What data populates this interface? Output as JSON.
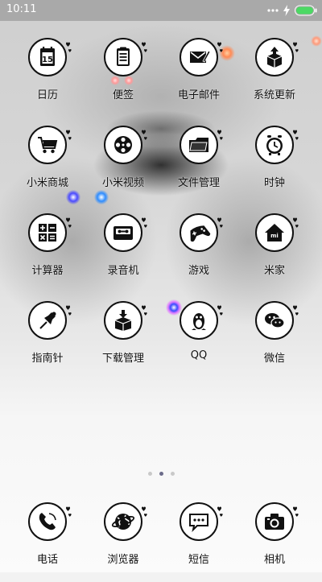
{
  "status_bar": {
    "time": "10:11",
    "battery_color": "#4cd964"
  },
  "home_apps": [
    {
      "label": "日历",
      "icon": "calendar-icon",
      "day": "15"
    },
    {
      "label": "便签",
      "icon": "notes-icon"
    },
    {
      "label": "电子邮件",
      "icon": "mail-icon"
    },
    {
      "label": "系统更新",
      "icon": "update-icon"
    },
    {
      "label": "小米商城",
      "icon": "shopping-cart-icon"
    },
    {
      "label": "小米视频",
      "icon": "film-reel-icon"
    },
    {
      "label": "文件管理",
      "icon": "folder-icon"
    },
    {
      "label": "时钟",
      "icon": "alarm-clock-icon"
    },
    {
      "label": "计算器",
      "icon": "calculator-icon"
    },
    {
      "label": "录音机",
      "icon": "cassette-icon"
    },
    {
      "label": "游戏",
      "icon": "gamepad-icon"
    },
    {
      "label": "米家",
      "icon": "home-icon",
      "badge": "mi"
    },
    {
      "label": "指南针",
      "icon": "compass-pin-icon"
    },
    {
      "label": "下载管理",
      "icon": "download-box-icon"
    },
    {
      "label": "QQ",
      "icon": "qq-penguin-icon"
    },
    {
      "label": "微信",
      "icon": "wechat-icon"
    }
  ],
  "page_indicator": {
    "pages": 3,
    "current": 2
  },
  "dock_apps": [
    {
      "label": "电话",
      "icon": "phone-icon"
    },
    {
      "label": "浏览器",
      "icon": "globe-browser-icon"
    },
    {
      "label": "短信",
      "icon": "message-bubble-icon"
    },
    {
      "label": "相机",
      "icon": "camera-icon"
    }
  ]
}
